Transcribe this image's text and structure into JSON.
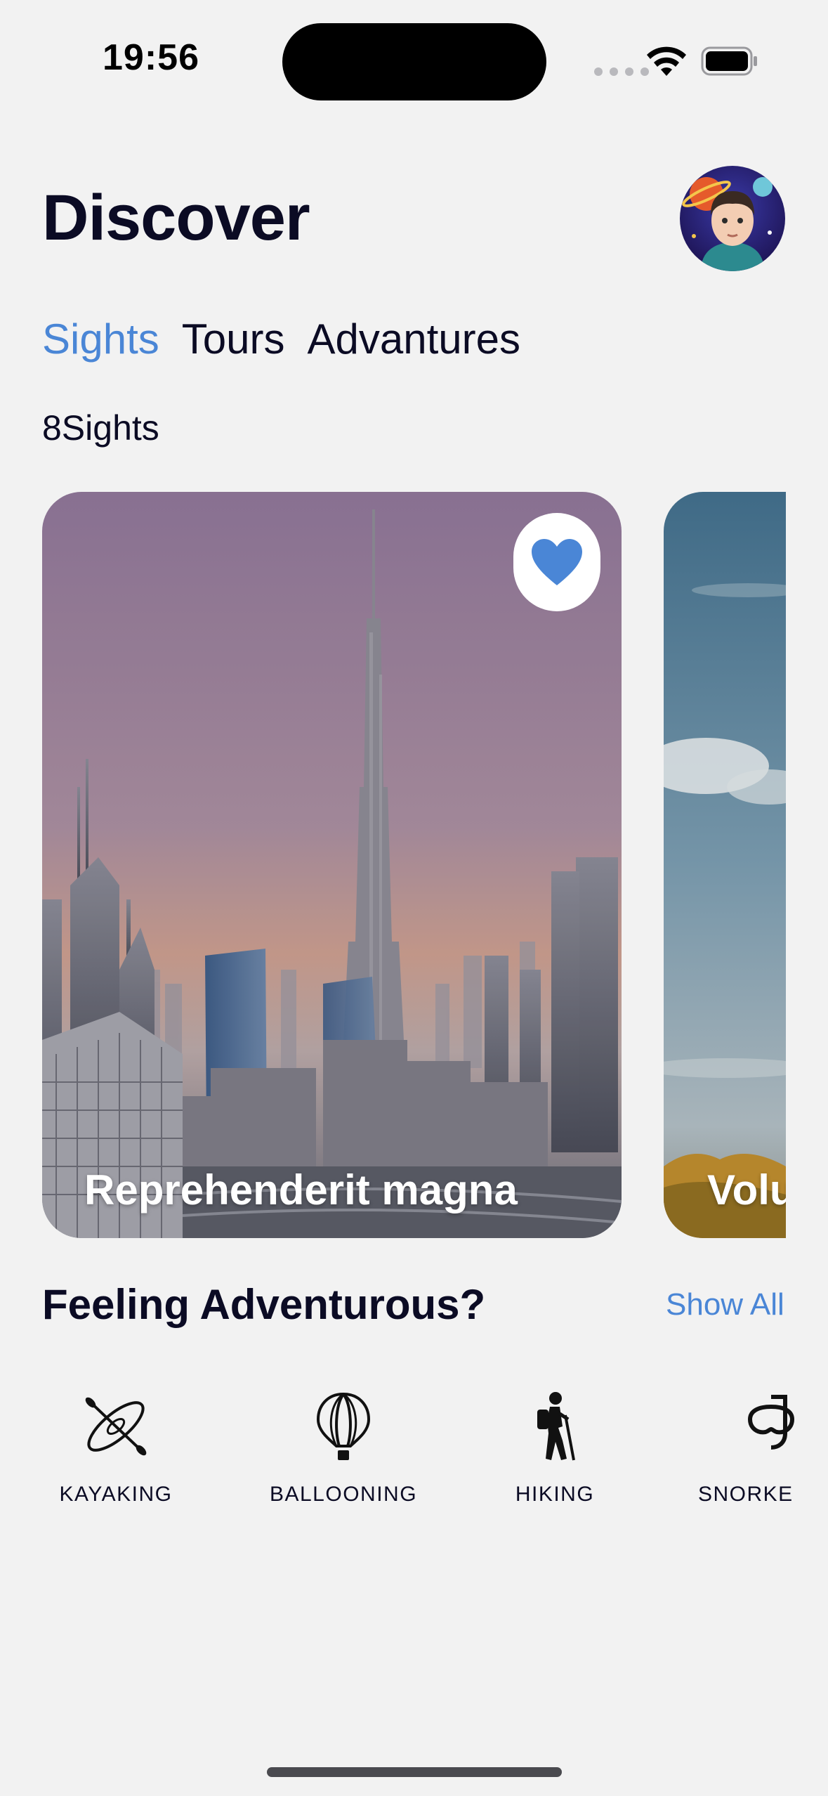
{
  "status_bar": {
    "time": "19:56"
  },
  "header": {
    "title": "Discover"
  },
  "tabs": [
    {
      "label": "Sights",
      "active": true
    },
    {
      "label": "Tours",
      "active": false
    },
    {
      "label": "Advantures",
      "active": false
    }
  ],
  "sights_count": "8Sights",
  "cards": [
    {
      "title": "Reprehenderit magna",
      "favorited": true
    },
    {
      "title": "Volu"
    }
  ],
  "section": {
    "title": "Feeling Adventurous?",
    "show_all": "Show All"
  },
  "activities": [
    {
      "label": "KAYAKING",
      "icon": "kayak-icon"
    },
    {
      "label": "BALLOONING",
      "icon": "hot-air-balloon-icon"
    },
    {
      "label": "HIKING",
      "icon": "hiker-icon"
    },
    {
      "label": "SNORKE",
      "icon": "snorkel-mask-icon"
    }
  ],
  "colors": {
    "accent": "#4a86d6",
    "text": "#0b0b24",
    "background": "#f2f2f2"
  }
}
